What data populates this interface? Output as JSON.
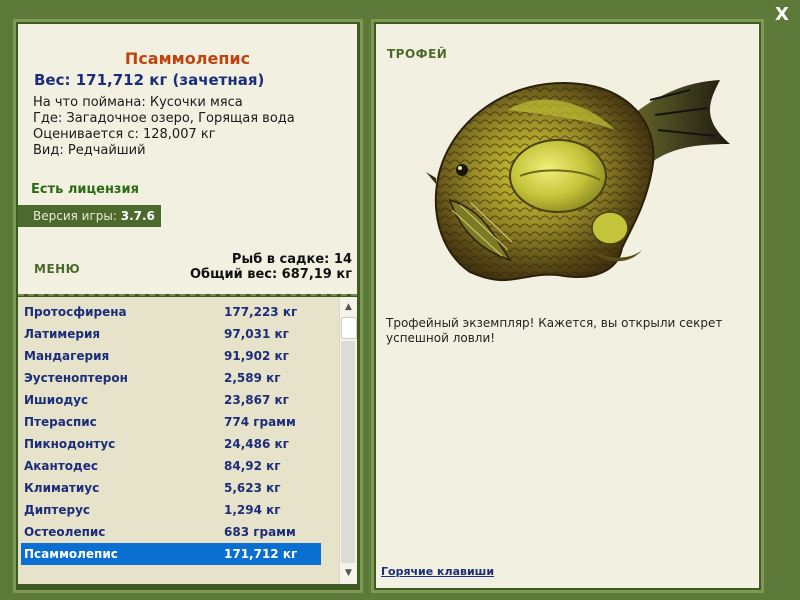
{
  "close_label": "X",
  "fish": {
    "name": "Псаммолепис",
    "weight_line": "Вес: 171,712 кг (зачетная)",
    "bait_line": "На что поймана: Кусочки мяса",
    "location_line": "Где: Загадочное озеро, Горящая вода",
    "value_line": "Оценивается с: 128,007 кг",
    "kind_line": "Вид: Редчайший"
  },
  "license": "Есть лицензия",
  "version": {
    "label": "Версия игры: ",
    "value": "3.7.6"
  },
  "menu_label": "МЕНЮ",
  "keepnet": {
    "count_line": "Рыб в садке: 14",
    "total_line": "Общий вес: 687,19 кг"
  },
  "catch_list": [
    {
      "name": "Протосфирена",
      "weight": "177,223 кг"
    },
    {
      "name": "Латимерия",
      "weight": "97,031 кг"
    },
    {
      "name": "Мандагерия",
      "weight": "91,902 кг"
    },
    {
      "name": "Эустеноптерон",
      "weight": "2,589 кг"
    },
    {
      "name": "Ишиодус",
      "weight": "23,867 кг"
    },
    {
      "name": "Птераспис",
      "weight": "774 грамм"
    },
    {
      "name": "Пикнодонтус",
      "weight": "24,486 кг"
    },
    {
      "name": "Акантодес",
      "weight": "84,92 кг"
    },
    {
      "name": "Климатиус",
      "weight": "5,623 кг"
    },
    {
      "name": "Диптерус",
      "weight": "1,294 кг"
    },
    {
      "name": "Остеолепис",
      "weight": "683 грамм"
    },
    {
      "name": "Псаммолепис",
      "weight": "171,712 кг",
      "selected": true
    }
  ],
  "trophy": {
    "label": "ТРОФЕЙ",
    "message": "Трофейный экземпляр! Кажется, вы открыли секрет успешной ловли!"
  },
  "hotkeys_label": "Горячие клавиши",
  "colors": {
    "background": "#5d7a3a",
    "panel": "#f2f1e1",
    "selected_row": "#0a6fd0",
    "accent_title": "#c0430e",
    "link_blue": "#1c2d7a"
  }
}
